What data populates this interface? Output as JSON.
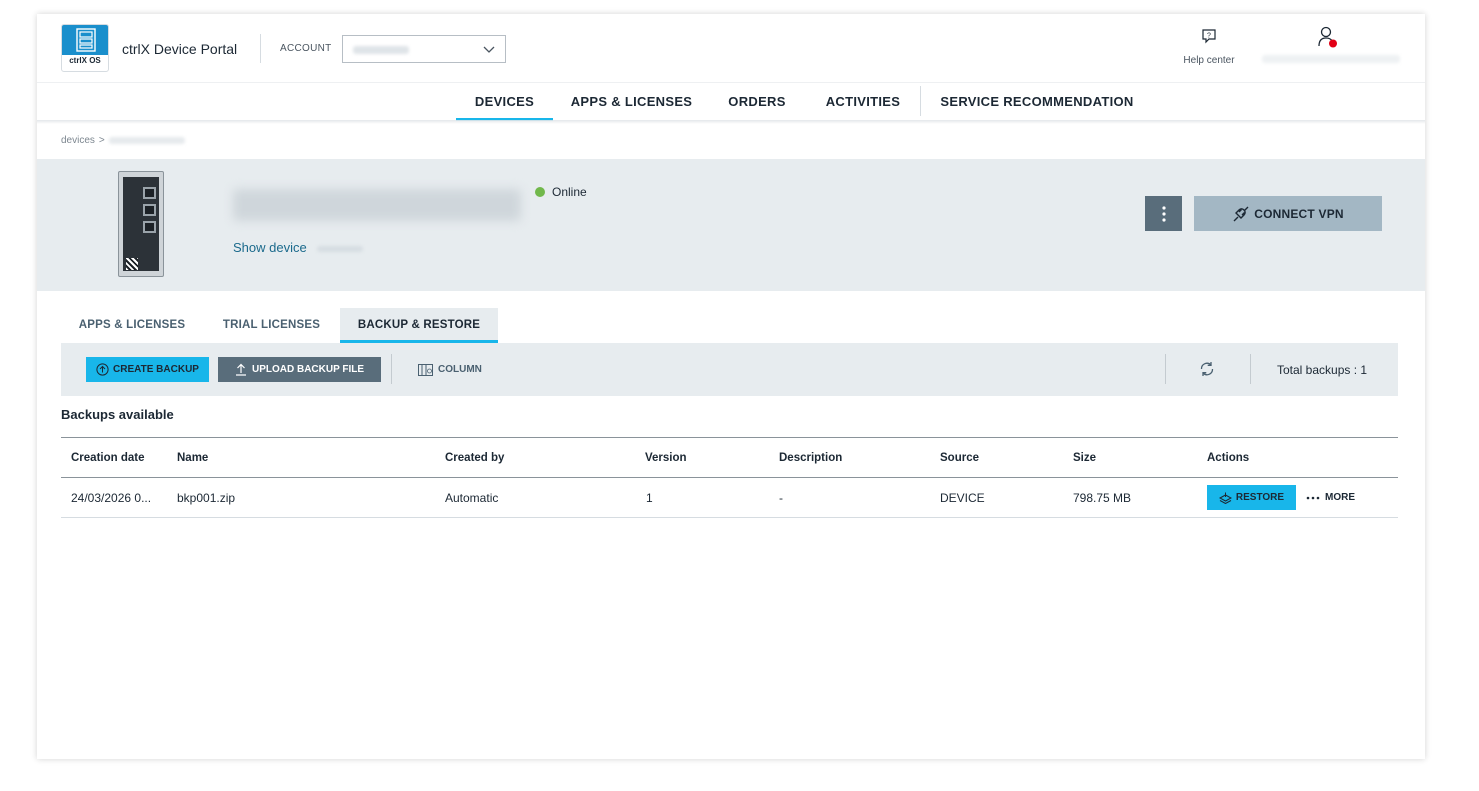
{
  "header": {
    "logo_text": "ctrlX OS",
    "app_title": "ctrlX Device Portal",
    "account_label": "ACCOUNT",
    "help_center_label": "Help center"
  },
  "nav": {
    "items": [
      {
        "label": "DEVICES",
        "active": true
      },
      {
        "label": "APPS & LICENSES",
        "active": false
      },
      {
        "label": "ORDERS",
        "active": false
      },
      {
        "label": "ACTIVITIES",
        "active": false
      },
      {
        "label": "SERVICE RECOMMENDATION",
        "active": false
      }
    ]
  },
  "breadcrumb": {
    "root": "devices",
    "separator": ">"
  },
  "device": {
    "status": "Online",
    "status_color": "#71b84b",
    "show_device_label": "Show device",
    "connect_vpn_label": "CONNECT VPN"
  },
  "tabs": [
    {
      "label": "APPS & LICENSES",
      "active": false
    },
    {
      "label": "TRIAL LICENSES",
      "active": false
    },
    {
      "label": "BACKUP & RESTORE",
      "active": true
    }
  ],
  "toolbar": {
    "create_backup_label": "CREATE BACKUP",
    "upload_backup_label": "UPLOAD BACKUP FILE",
    "column_label": "COLUMN",
    "total_backups": "Total backups : 1"
  },
  "section_title": "Backups available",
  "table": {
    "headers": [
      "Creation date",
      "Name",
      "Created by",
      "Version",
      "Description",
      "Source",
      "Size",
      "Actions"
    ],
    "rows": [
      {
        "creation_date": "24/03/2026 0...",
        "name": "bkp001.zip",
        "created_by": "Automatic",
        "version": "1",
        "description": "-",
        "source": "DEVICE",
        "size": "798.75 MB",
        "restore_label": "RESTORE",
        "more_label": "MORE"
      }
    ]
  },
  "colors": {
    "accent": "#18b6ea",
    "slate_button": "#596d7b",
    "band_background": "#e7ecef",
    "vpn_button": "#a3b7c4",
    "notification_dot": "#e20015"
  }
}
